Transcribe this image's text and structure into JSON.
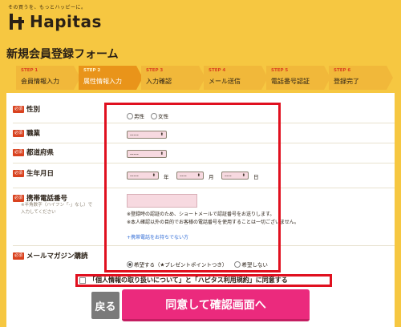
{
  "header": {
    "tagline": "その買うを、もっとハッピーに。",
    "logo_text": "Hapitas"
  },
  "page_title": "新規会員登録フォーム",
  "steps": [
    {
      "num": "STEP 1",
      "label": "会員情報入力",
      "active": false
    },
    {
      "num": "STEP 2",
      "label": "属性情報入力",
      "active": true
    },
    {
      "num": "STEP 3",
      "label": "入力確認",
      "active": false
    },
    {
      "num": "STEP 4",
      "label": "メール送信",
      "active": false
    },
    {
      "num": "STEP 5",
      "label": "電話番号認証",
      "active": false
    },
    {
      "num": "STEP 6",
      "label": "登録完了",
      "active": false
    }
  ],
  "form": {
    "required_badge": "必須",
    "gender": {
      "label": "性別",
      "options": [
        "男性",
        "女性"
      ]
    },
    "occupation": {
      "label": "職業",
      "value": "-----"
    },
    "prefecture": {
      "label": "都道府県",
      "value": "-----"
    },
    "birthday": {
      "label": "生年月日",
      "year": "-----",
      "year_unit": "年",
      "month": "----",
      "month_unit": "月",
      "day": "----",
      "day_unit": "日"
    },
    "phone": {
      "label": "携帯電話番号",
      "hint_line1": "※半角数字（ハイフン「-」なし）で",
      "hint_line2": "入力してください",
      "note1": "※登録時の認証のため、ショートメールで認証番号をお送りします。",
      "note2": "※本人確認以外の目的でお客様の電話番号を使用することは一切ございません。",
      "no_phone_link": "+携帯電話をお持ちでない方"
    },
    "magazine": {
      "label": "メールマガジン購読",
      "opt_yes": "希望する（★プレゼントポイントつき）",
      "opt_no": "希望しない"
    }
  },
  "agree_text": "「個人情報の取り扱いについて」と「ハピタス利用規約」に同意する",
  "buttons": {
    "back": "戻る",
    "confirm": "同意して確認画面へ"
  },
  "colors": {
    "background": "#f6c741",
    "active_step": "#e9941a",
    "required": "#d9421f",
    "highlight_box": "#e0101f",
    "confirm_button": "#eb2a7d"
  }
}
